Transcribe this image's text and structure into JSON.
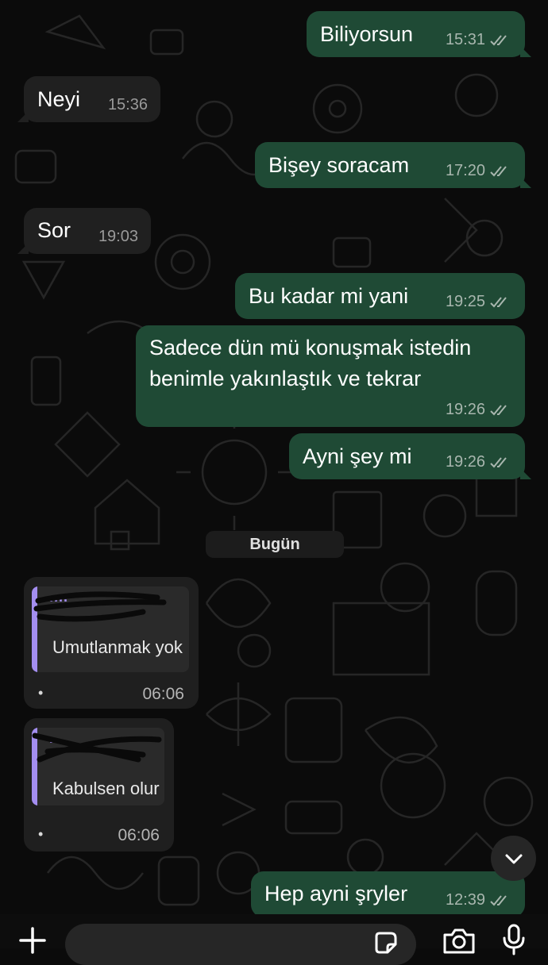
{
  "chat": {
    "messages": [
      {
        "text": "Biliyorsun",
        "time": "15:31"
      },
      {
        "text": "Neyi",
        "time": "15:36"
      },
      {
        "text": "Bişey soracam",
        "time": "17:20"
      },
      {
        "text": "Sor",
        "time": "19:03"
      },
      {
        "text": "Bu kadar mi yani",
        "time": "19:25"
      },
      {
        "text_line1": "Sadece dün mü konuşmak istedin",
        "text_line2": "benimle yakınlaştık ve tekrar",
        "time": "19:26"
      },
      {
        "text": "Ayni şey mi",
        "time": "19:26"
      }
    ],
    "date_separator": "Bugün",
    "quoted_replies": [
      {
        "sender": "····",
        "quote": "Umutlanmak yok",
        "dot": "•",
        "time": "06:06"
      },
      {
        "sender": "····",
        "quote": "Kabulsen olur",
        "dot": "•",
        "time": "06:06"
      }
    ],
    "last_message": {
      "text": "Hep ayni şryler",
      "time": "12:39"
    }
  },
  "colors": {
    "outgoing_bubble": "#1f4a35",
    "incoming_bubble": "#202020",
    "quote_accent": "#a48ef0",
    "background": "#0b0b0b"
  },
  "icons": [
    "double-check-icon",
    "chevron-down-icon",
    "plus-icon",
    "sticker-icon",
    "camera-icon",
    "mic-icon"
  ]
}
